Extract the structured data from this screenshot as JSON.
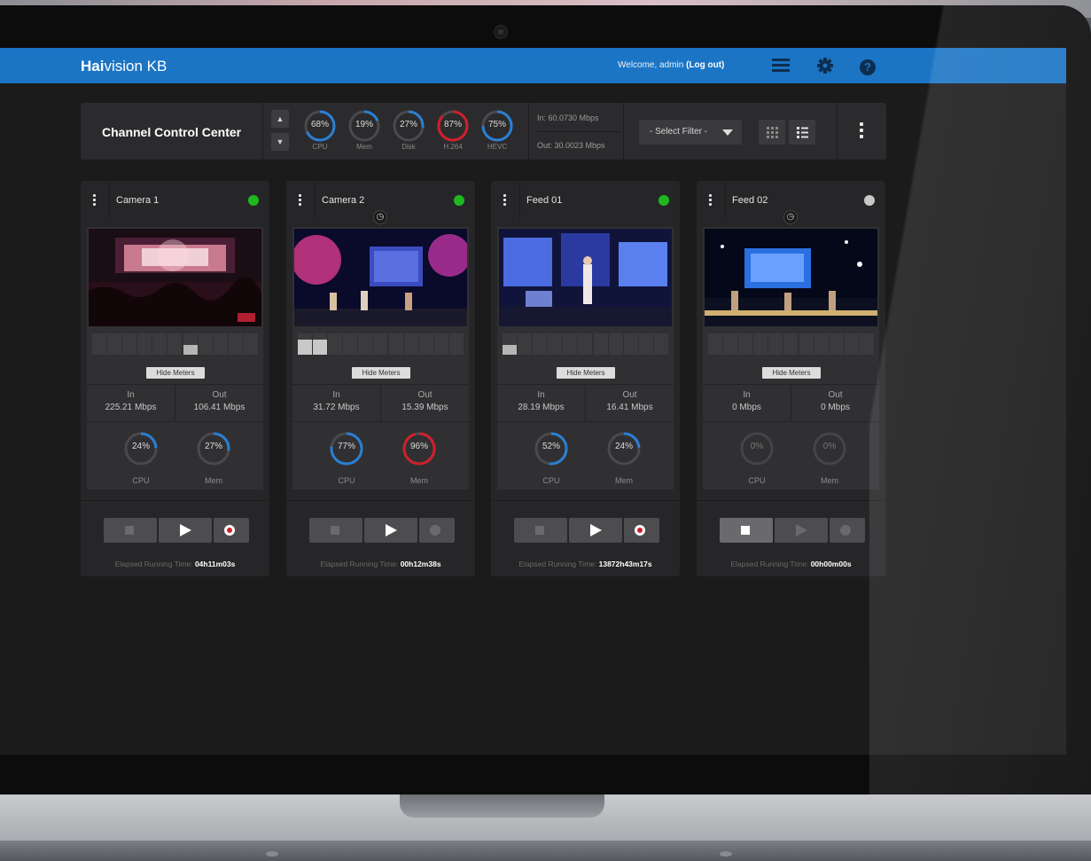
{
  "app": {
    "brand_bold": "Hai",
    "brand_rest": "vision KB",
    "welcome_prefix": "Welcome, admin ",
    "logout_label": "(Log out)",
    "help_glyph": "?"
  },
  "control_bar": {
    "title": "Channel Control Center",
    "stats": [
      {
        "value": "68%",
        "label": "CPU",
        "percent": 68,
        "color": "#2a7fd4"
      },
      {
        "value": "19%",
        "label": "Mem",
        "percent": 19,
        "color": "#2a7fd4"
      },
      {
        "value": "27%",
        "label": "Disk",
        "percent": 27,
        "color": "#2a7fd4"
      },
      {
        "value": "87%",
        "label": "H.264",
        "percent": 87,
        "color": "#d0202c"
      },
      {
        "value": "75%",
        "label": "HEVC",
        "percent": 75,
        "color": "#2a7fd4"
      }
    ],
    "in_rate": "In: 60.0730 Mbps",
    "out_rate": "Out: 30.0023 Mbps",
    "filter_label": "- Select Filter -"
  },
  "channels": [
    {
      "name": "Camera 1",
      "status_color": "#1fb81f",
      "scheduled": false,
      "hide_meters": "Hide Meters",
      "in_label": "In",
      "in_value": "225.21 Mbps",
      "out_label": "Out",
      "out_value": "106.41 Mbps",
      "cpu": {
        "value": "24%",
        "label": "CPU",
        "percent": 24,
        "color": "#2a7fd4"
      },
      "mem": {
        "value": "27%",
        "label": "Mem",
        "percent": 27,
        "color": "#2a7fd4"
      },
      "elapsed_label": "Elapsed Running Time: ",
      "elapsed_value": "04h11m03s"
    },
    {
      "name": "Camera 2",
      "status_color": "#1fb81f",
      "scheduled": true,
      "hide_meters": "Hide Meters",
      "in_label": "In",
      "in_value": "31.72 Mbps",
      "out_label": "Out",
      "out_value": "15.39 Mbps",
      "cpu": {
        "value": "77%",
        "label": "CPU",
        "percent": 77,
        "color": "#2a7fd4"
      },
      "mem": {
        "value": "96%",
        "label": "Mem",
        "percent": 96,
        "color": "#d0202c"
      },
      "elapsed_label": "Elapsed Running Time: ",
      "elapsed_value": "00h12m38s"
    },
    {
      "name": "Feed 01",
      "status_color": "#1fb81f",
      "scheduled": false,
      "hide_meters": "Hide Meters",
      "in_label": "In",
      "in_value": "28.19 Mbps",
      "out_label": "Out",
      "out_value": "16.41 Mbps",
      "cpu": {
        "value": "52%",
        "label": "CPU",
        "percent": 52,
        "color": "#2a7fd4"
      },
      "mem": {
        "value": "24%",
        "label": "Mem",
        "percent": 24,
        "color": "#2a7fd4"
      },
      "elapsed_label": "Elapsed Running Time: ",
      "elapsed_value": "13872h43m17s"
    },
    {
      "name": "Feed 02",
      "status_color": "#c8c8c8",
      "scheduled": true,
      "hide_meters": "Hide Meters",
      "in_label": "In",
      "in_value": "0 Mbps",
      "out_label": "Out",
      "out_value": "0 Mbps",
      "cpu": {
        "value": "0%",
        "label": "CPU",
        "percent": 0,
        "color": "#2a7fd4"
      },
      "mem": {
        "value": "0%",
        "label": "Mem",
        "percent": 0,
        "color": "#2a7fd4"
      },
      "elapsed_label": "Elapsed Running Time: ",
      "elapsed_value": "00h00m00s"
    }
  ]
}
